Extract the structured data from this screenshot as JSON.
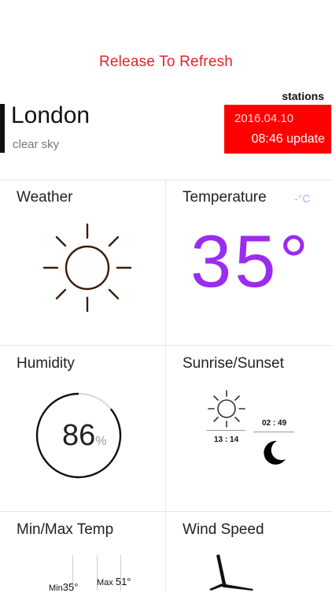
{
  "pull_to_refresh": {
    "label": "Release To Refresh"
  },
  "location": {
    "city": "London",
    "condition": "clear sky",
    "stations_label": "stations",
    "date": "2016.04.10",
    "update_label": "08:46 update"
  },
  "tiles": {
    "weather": {
      "title": "Weather",
      "icon": "sun-icon"
    },
    "temperature": {
      "title": "Temperature",
      "unit": "-°C",
      "value": "35°",
      "color": "#9a2cf0"
    },
    "humidity": {
      "title": "Humidity",
      "value": "86",
      "unit": "%",
      "level_percent": 86
    },
    "sun": {
      "title": "Sunrise/Sunset",
      "sunrise": "13 : 14",
      "sunset": "02 : 49"
    },
    "minmax": {
      "title": "Min/Max Temp",
      "min_label": "Min",
      "min_value": "35°",
      "max_label": "Max",
      "max_value": "51°"
    },
    "wind": {
      "title": "Wind Speed",
      "icon": "wind-turbine-icon"
    }
  },
  "colors": {
    "accent": "#ff0000",
    "refresh_text": "#e8202a",
    "sun_stroke": "#3a1c0c"
  }
}
